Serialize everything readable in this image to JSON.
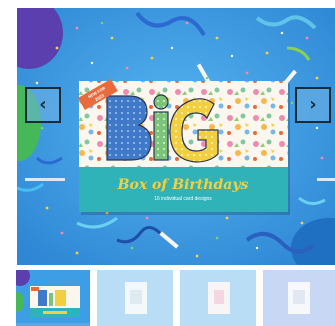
{
  "gallery": {
    "product_title": "BiG",
    "subtitle": "Box of Birthdays",
    "tagline": "16 individual card designs",
    "badge_top": "NEW FOR",
    "badge_bottom": "2023",
    "prev_icon": "chevron-left-icon",
    "next_icon": "chevron-right-icon",
    "prev_glyph": "‹",
    "next_glyph": "›",
    "active_thumbnail": 1,
    "thumbnail_count": 4
  },
  "colors": {
    "background": "#3d9ee6",
    "card_teal": "#2fb3b8",
    "subtitle_yellow": "#f4d03f",
    "badge_orange": "#e96a3b",
    "nav_border": "#1b2a35"
  }
}
